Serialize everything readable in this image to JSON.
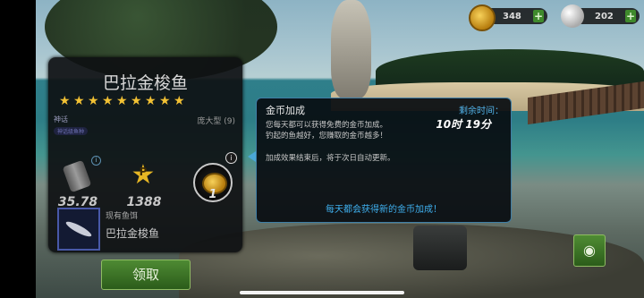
{
  "currency": {
    "gold": {
      "icon": "gold-coin-icon",
      "value": "348",
      "add": "+"
    },
    "pearls": {
      "icon": "pearl-icon",
      "value": "202",
      "add": "+"
    }
  },
  "fish_panel": {
    "name": "巴拉金梭鱼",
    "stars": [
      "★",
      "★",
      "★",
      "★",
      "★",
      "★",
      "★",
      "★",
      "★"
    ],
    "rarity": "神话",
    "rarity_badge": "神话级鱼种",
    "size_class": "庞大型 (9)",
    "weight": "35.78",
    "points": "1388",
    "points_letter": "P",
    "coins": "1",
    "info": "i",
    "bait_label": "现有鱼饵",
    "bait_name": "巴拉金梭鱼"
  },
  "claim_button": "领取",
  "tooltip": {
    "title": "金币加成",
    "description": "您每天都可以获得免费的金币加成。\n钓起的鱼越好，您赚取的金币越多！",
    "remaining_label": "剩余时间：",
    "remaining_time": "10时 19分",
    "note": "加成效果结束后，将于次日自动更新。",
    "footer": "每天都会获得新的金币加成！"
  },
  "camera_icon": "camera-icon",
  "colors": {
    "accent_blue": "#3fb0ef",
    "button_green": "#3f7a28",
    "star_gold": "#f2c134"
  }
}
